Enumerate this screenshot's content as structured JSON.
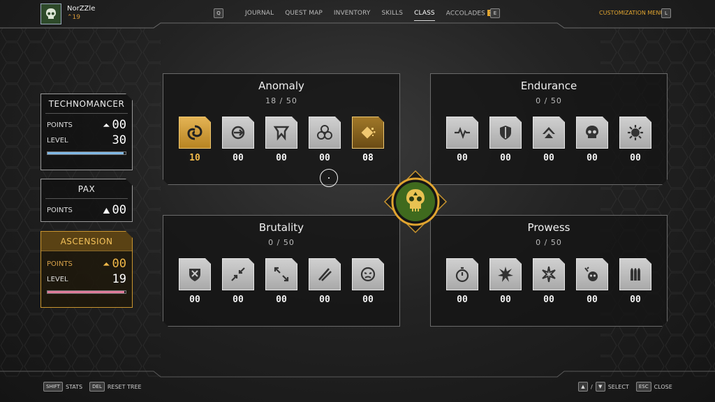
{
  "player": {
    "name": "NorZZle",
    "level": "19",
    "avatar_icon": "skull-icon"
  },
  "nav": {
    "prev_key": "Q",
    "next_key": "E",
    "tabs": [
      {
        "label": "JOURNAL"
      },
      {
        "label": "QUEST MAP"
      },
      {
        "label": "INVENTORY"
      },
      {
        "label": "SKILLS"
      },
      {
        "label": "CLASS",
        "active": true
      },
      {
        "label": "ACCOLADES",
        "badge": "1"
      }
    ],
    "customization_label": "CUSTOMIZATION MENU",
    "customization_key": "L"
  },
  "cards": {
    "technomancer": {
      "title": "TECHNOMANCER",
      "points_label": "POINTS",
      "points": "00",
      "level_label": "LEVEL",
      "level": "30",
      "progress": 0.97
    },
    "pax": {
      "title": "PAX",
      "points_label": "POINTS",
      "points": "00"
    },
    "ascension": {
      "title": "ASCENSION",
      "points_label": "POINTS",
      "points": "00",
      "level_label": "LEVEL",
      "level": "19",
      "progress": 0.98
    }
  },
  "trees": {
    "anomaly": {
      "title": "Anomaly",
      "count": "18 / 50",
      "skills": [
        {
          "icon": "vortex-icon",
          "value": "10"
        },
        {
          "icon": "burst-icon",
          "value": "00"
        },
        {
          "icon": "fang-icon",
          "value": "00"
        },
        {
          "icon": "biohazard-icon",
          "value": "00"
        },
        {
          "icon": "shatter-icon",
          "value": "08"
        }
      ]
    },
    "endurance": {
      "title": "Endurance",
      "count": "0 / 50",
      "skills": [
        {
          "icon": "heartbeat-icon",
          "value": "00"
        },
        {
          "icon": "shield-icon",
          "value": "00"
        },
        {
          "icon": "arrow-up-icon",
          "value": "00"
        },
        {
          "icon": "skull-icon",
          "value": "00"
        },
        {
          "icon": "gear-burst-icon",
          "value": "00"
        }
      ]
    },
    "brutality": {
      "title": "Brutality",
      "count": "0 / 50",
      "skills": [
        {
          "icon": "armor-icon",
          "value": "00"
        },
        {
          "icon": "arrows-in-icon",
          "value": "00"
        },
        {
          "icon": "arrows-out-icon",
          "value": "00"
        },
        {
          "icon": "blades-icon",
          "value": "00"
        },
        {
          "icon": "face-icon",
          "value": "00"
        }
      ]
    },
    "prowess": {
      "title": "Prowess",
      "count": "0 / 50",
      "skills": [
        {
          "icon": "stopwatch-icon",
          "value": "00"
        },
        {
          "icon": "explosion-icon",
          "value": "00"
        },
        {
          "icon": "spark-icon",
          "value": "00"
        },
        {
          "icon": "skull-bomb-icon",
          "value": "00"
        },
        {
          "icon": "bullets-icon",
          "value": "00"
        }
      ]
    }
  },
  "footer": {
    "stats_key": "SHIFT",
    "stats_label": "STATS",
    "reset_key": "DEL",
    "reset_label": "RESET TREE",
    "select_label": "SELECT",
    "slash": "/",
    "close_key": "ESC",
    "close_label": "CLOSE"
  },
  "colors": {
    "gold": "#e1a530",
    "blue_bar": "#7fb8e6",
    "pink_bar": "#e07a9a",
    "emblem_green": "#3f6a1e"
  }
}
